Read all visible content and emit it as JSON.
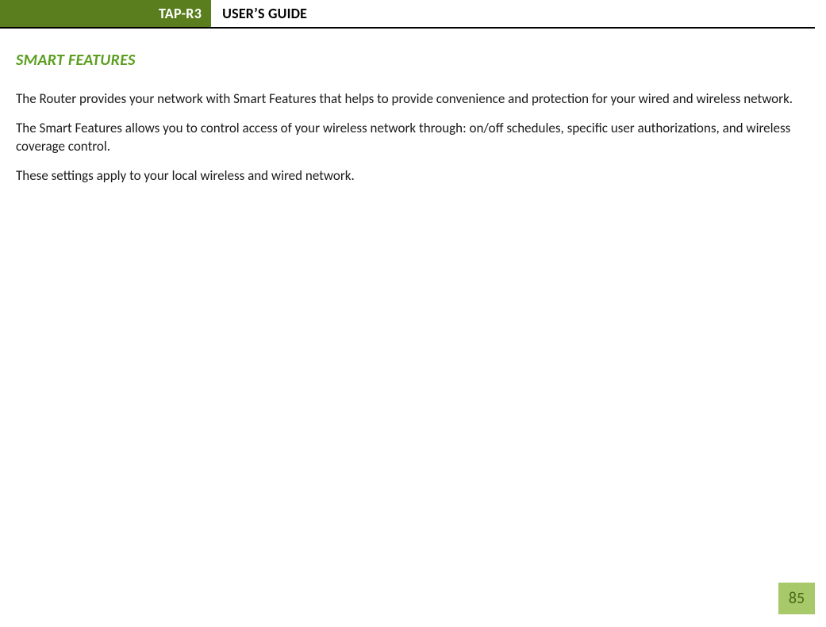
{
  "header": {
    "badge": "TAP-R3",
    "title": "USER’S GUIDE"
  },
  "section": {
    "heading": "SMART FEATURES",
    "paragraphs": [
      "The Router provides your network with Smart Features that helps to provide convenience and protection for your wired and wireless network.",
      "The Smart Features allows you to control access of your wireless network through: on/off schedules, specific user authorizations, and wireless coverage control.",
      "These settings apply to your local wireless and wired network."
    ]
  },
  "page_number": "85",
  "colors": {
    "badge_bg": "#5a7e1e",
    "heading_green": "#5a9e1e",
    "page_num_bg": "#a7c96a",
    "page_num_fg": "#4a6a17"
  }
}
